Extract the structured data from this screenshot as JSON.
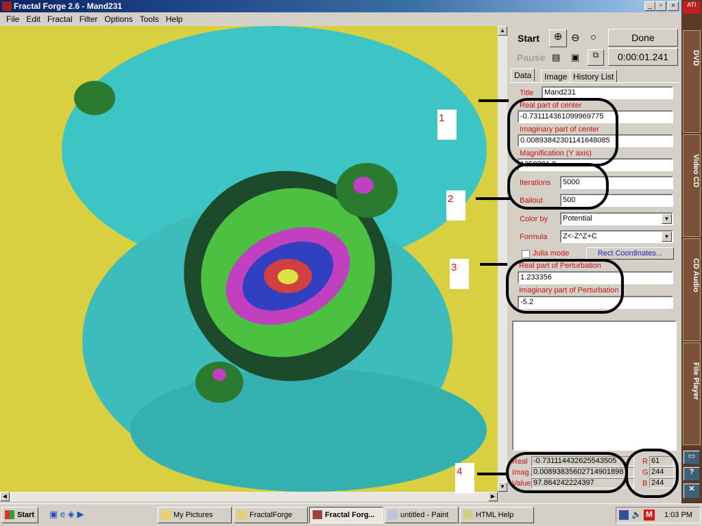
{
  "window": {
    "title": "Fractal Forge 2.6 - Mand231"
  },
  "menu": [
    "File",
    "Edit",
    "Fractal",
    "Filter",
    "Options",
    "Tools",
    "Help"
  ],
  "toolbar": {
    "start": "Start",
    "pause": "Pause",
    "status": "Done",
    "timer": "0:00:01.241"
  },
  "tabs": [
    "Data",
    "Image",
    "History List"
  ],
  "fields": {
    "title_label": "Title",
    "title": "Mand231",
    "real_center_label": "Real part of center",
    "real_center": "-0.731114361099969775",
    "imag_center_label": "Imaginary part of center",
    "imag_center": "0.00893842301141648085",
    "mag_label": "Magnification (Y axis)",
    "mag": "1258291.2",
    "iter_label": "Iterations",
    "iter": "5000",
    "bailout_label": "Bailout",
    "bailout": "500",
    "colorby_label": "Color by",
    "colorby": "Potential",
    "formula_label": "Formula",
    "formula": "Z<-Z^Z+C",
    "julia_label": "Julia mode",
    "rect_btn": "Rect Coordinates...",
    "real_pert_label": "Real part of Perturbation",
    "real_pert": "1.233356",
    "imag_pert_label": "Imaginary part of Perturbation",
    "imag_pert": "-5.2"
  },
  "readout": {
    "real_label": "Real",
    "real": "-0.731114432625543505",
    "imag_label": "Imag.",
    "imag": "0.00893835602714901898",
    "value_label": "Value",
    "value": "97.864242224397",
    "r_label": "R",
    "r": "61",
    "g_label": "G",
    "g": "244",
    "b_label": "B",
    "b": "244"
  },
  "annotations": [
    "1",
    "2",
    "3",
    "4"
  ],
  "sidebar": [
    "DVD",
    "Video CD",
    "CD Audio",
    "File Player"
  ],
  "taskbar": {
    "start": "Start",
    "tasks": [
      "My Pictures",
      "FractalForge",
      "Fractal Forg...",
      "untitled - Paint",
      "HTML Help"
    ],
    "clock": "1:03 PM"
  },
  "colors": {
    "label": "#d01010",
    "titlebar": "#0a246a",
    "fractal_yellow": "#d8d040",
    "fractal_cyan": "#3dc4c4"
  }
}
